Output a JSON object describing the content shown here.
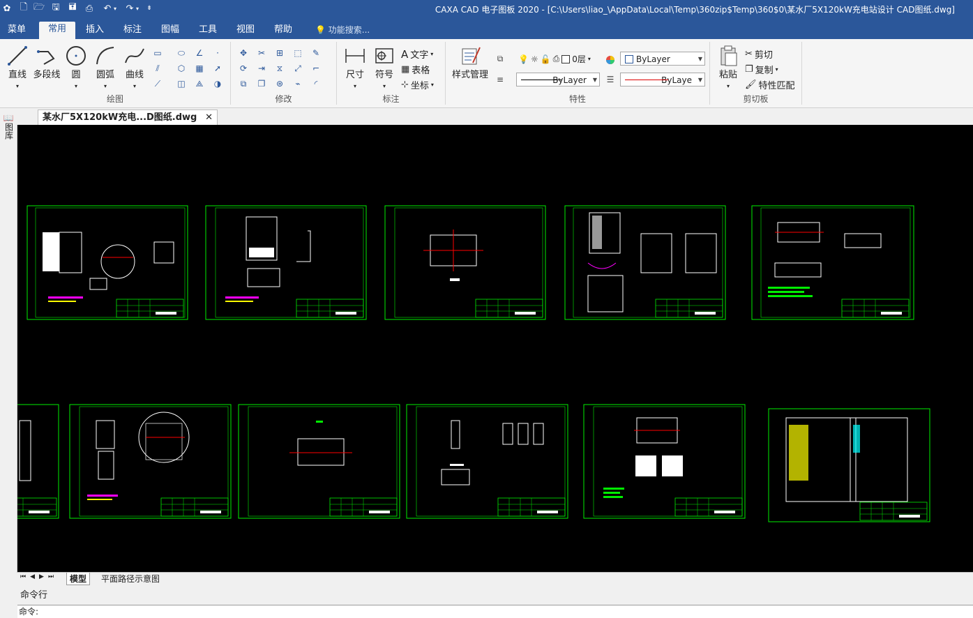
{
  "window": {
    "title": "CAXA CAD 电子图板 2020 - [C:\\Users\\liao_\\AppData\\Local\\Temp\\360zip$Temp\\360$0\\某水厂5X120kW充电站设计 CAD图纸.dwg]"
  },
  "menubar": {
    "tabs": [
      {
        "label": "菜单"
      },
      {
        "label": "常用"
      },
      {
        "label": "插入"
      },
      {
        "label": "标注"
      },
      {
        "label": "图幅"
      },
      {
        "label": "工具"
      },
      {
        "label": "视图"
      },
      {
        "label": "帮助"
      }
    ],
    "search_placeholder": "功能搜索..."
  },
  "ribbon": {
    "draw": {
      "label": "绘图",
      "line": "直线",
      "polyline": "多段线",
      "circle": "圆",
      "arc": "圆弧",
      "curve": "曲线"
    },
    "modify": {
      "label": "修改"
    },
    "annotate": {
      "label": "标注",
      "dimension": "尺寸",
      "symbol": "符号",
      "text": "文字",
      "table": "表格",
      "coord": "坐标"
    },
    "properties": {
      "label": "特性",
      "style_manager": "样式管理",
      "layer": "0层",
      "color": "ByLayer",
      "linetype": "ByLayer",
      "lineweight": "ByLaye"
    },
    "clipboard": {
      "label": "剪切板",
      "paste": "粘贴",
      "cut": "剪切",
      "copy": "复制",
      "match": "特性匹配"
    }
  },
  "left_panel": {
    "label": "图库"
  },
  "document": {
    "tab_title": "某水厂5X120kW充电...D图纸.dwg"
  },
  "layout": {
    "model": "模型",
    "layout1": "平面路径示意图"
  },
  "command": {
    "header": "命令行",
    "prompt": "命令:"
  },
  "colors": {
    "title_bar": "#2b579a",
    "canvas": "#000000",
    "frame": "#00e000"
  }
}
